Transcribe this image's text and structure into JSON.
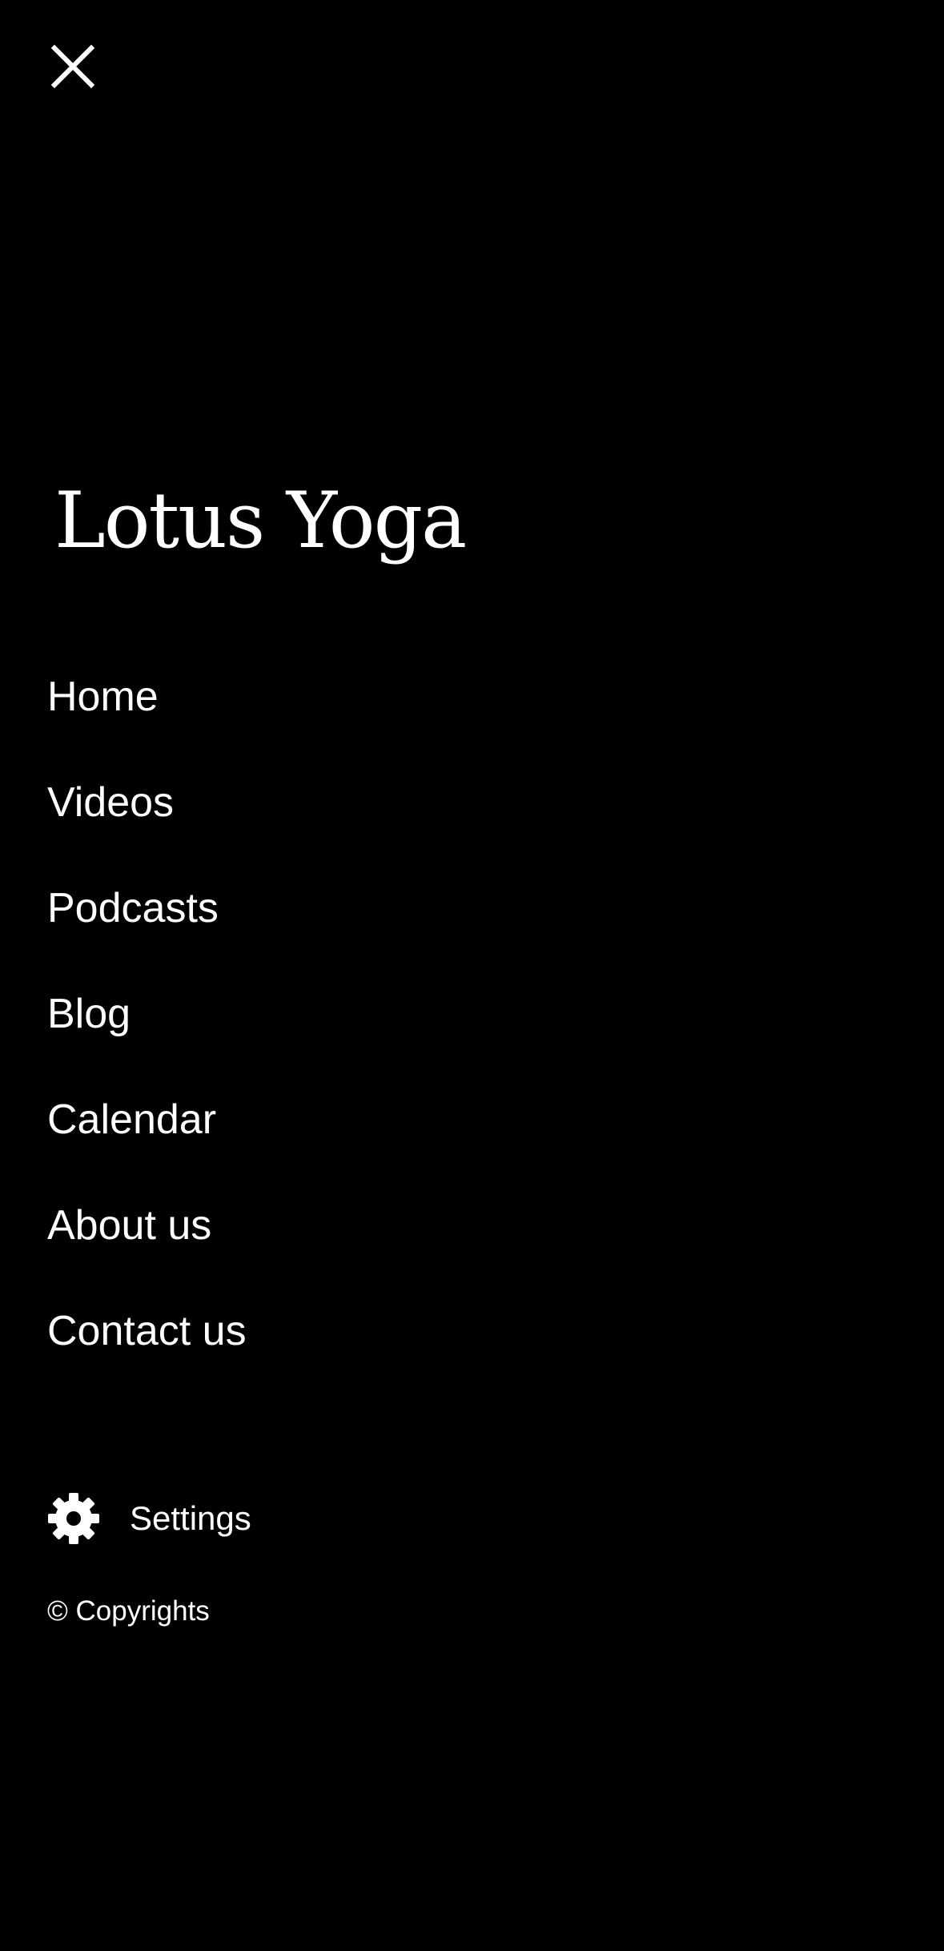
{
  "header": {
    "close_icon": "close-icon"
  },
  "brand": {
    "title": "Lotus Yoga"
  },
  "nav": {
    "items": [
      {
        "label": "Home"
      },
      {
        "label": "Videos"
      },
      {
        "label": "Podcasts"
      },
      {
        "label": "Blog"
      },
      {
        "label": "Calendar"
      },
      {
        "label": "About us"
      },
      {
        "label": "Contact us"
      }
    ]
  },
  "settings": {
    "icon": "gear-icon",
    "label": "Settings"
  },
  "footer": {
    "copyright": "© Copyrights"
  },
  "colors": {
    "background": "#000000",
    "text": "#ffffff"
  }
}
